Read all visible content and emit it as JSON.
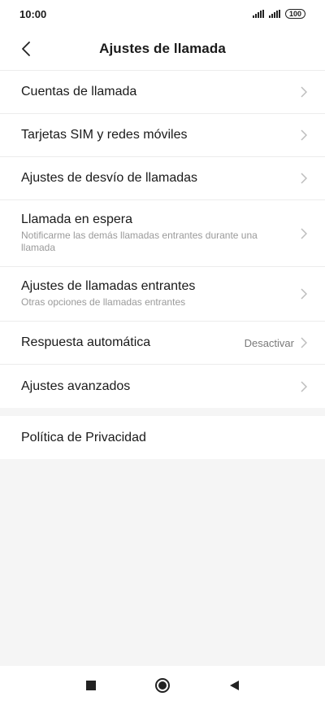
{
  "status": {
    "time": "10:00",
    "battery": "100"
  },
  "header": {
    "title": "Ajustes de llamada"
  },
  "settings": [
    {
      "label": "Cuentas de llamada"
    },
    {
      "label": "Tarjetas SIM y redes móviles"
    },
    {
      "label": "Ajustes de desvío de llamadas"
    },
    {
      "label": "Llamada en espera",
      "subtitle": "Notificarme las demás llamadas entrantes durante una llamada"
    },
    {
      "label": "Ajustes de llamadas entrantes",
      "subtitle": "Otras opciones de llamadas entrantes"
    },
    {
      "label": "Respuesta automática",
      "value": "Desactivar"
    },
    {
      "label": "Ajustes avanzados"
    }
  ],
  "privacy": {
    "label": "Política de Privacidad"
  },
  "icons": {
    "back": "back-arrow-icon",
    "chevron": "chevron-right-icon",
    "nav": [
      "square-recents-icon",
      "circle-home-icon",
      "triangle-back-icon"
    ]
  }
}
